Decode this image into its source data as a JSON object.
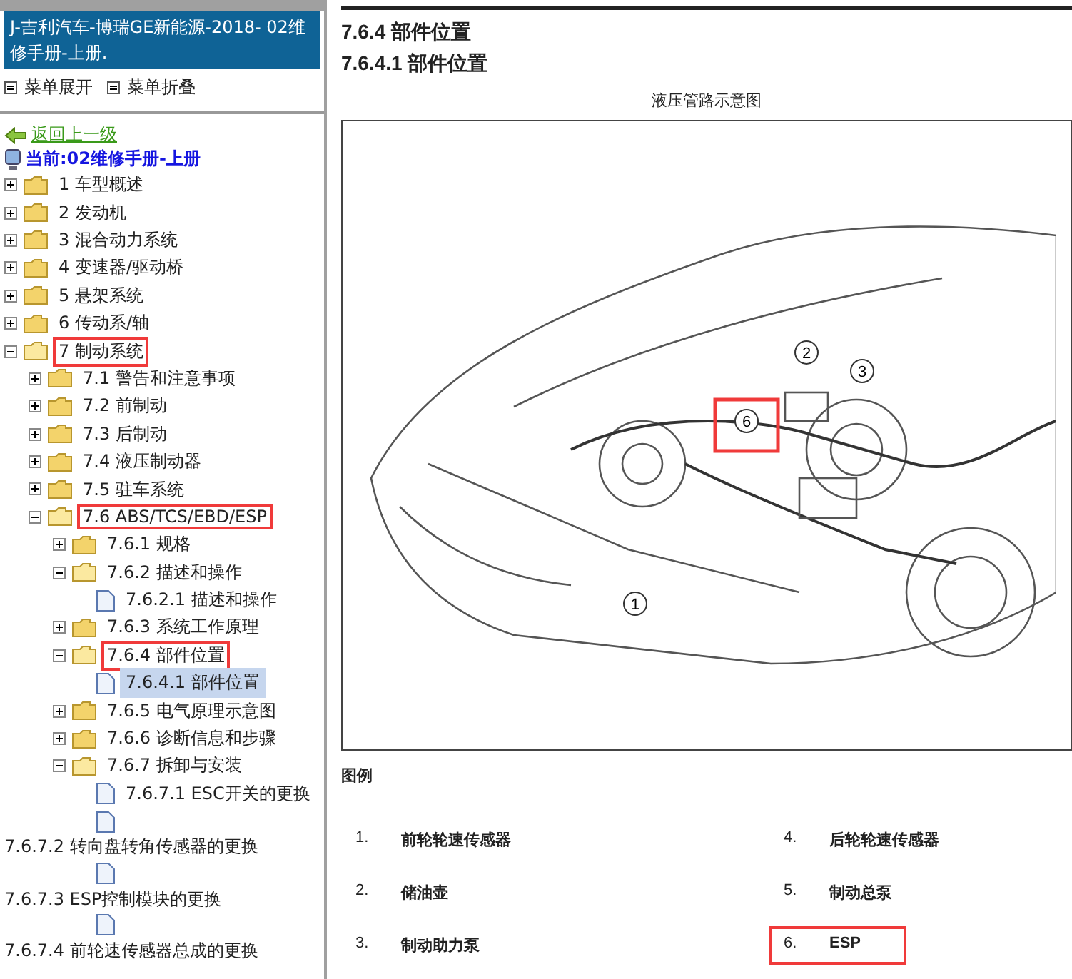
{
  "sidebar": {
    "title": "J-吉利汽车-博瑞GE新能源-2018- 02维修手册-上册.",
    "menu_actions": [
      "菜单展开",
      "菜单折叠"
    ],
    "back_link": "返回上一级",
    "current": "当前:02维修手册-上册",
    "tree": [
      {
        "label": "1 车型概述",
        "kind": "folder",
        "expanded": false,
        "highlighted": false,
        "selected": false
      },
      {
        "label": "2 发动机",
        "kind": "folder",
        "expanded": false,
        "highlighted": false,
        "selected": false
      },
      {
        "label": "3 混合动力系统",
        "kind": "folder",
        "expanded": false,
        "highlighted": false,
        "selected": false
      },
      {
        "label": "4 变速器/驱动桥",
        "kind": "folder",
        "expanded": false,
        "highlighted": false,
        "selected": false
      },
      {
        "label": "5 悬架系统",
        "kind": "folder",
        "expanded": false,
        "highlighted": false,
        "selected": false
      },
      {
        "label": "6 传动系/轴",
        "kind": "folder",
        "expanded": false,
        "highlighted": false,
        "selected": false
      },
      {
        "label": "7 制动系统",
        "kind": "folder",
        "expanded": true,
        "highlighted": true,
        "selected": false,
        "children": [
          {
            "label": "7.1 警告和注意事项",
            "kind": "folder",
            "expanded": false,
            "highlighted": false,
            "selected": false
          },
          {
            "label": "7.2 前制动",
            "kind": "folder",
            "expanded": false,
            "highlighted": false,
            "selected": false
          },
          {
            "label": "7.3 后制动",
            "kind": "folder",
            "expanded": false,
            "highlighted": false,
            "selected": false
          },
          {
            "label": "7.4 液压制动器",
            "kind": "folder",
            "expanded": false,
            "highlighted": false,
            "selected": false
          },
          {
            "label": "7.5 驻车系统",
            "kind": "folder",
            "expanded": false,
            "highlighted": false,
            "selected": false
          },
          {
            "label": "7.6 ABS/TCS/EBD/ESP",
            "kind": "folder",
            "expanded": true,
            "highlighted": true,
            "selected": false,
            "children": [
              {
                "label": "7.6.1 规格",
                "kind": "folder",
                "expanded": false,
                "highlighted": false,
                "selected": false
              },
              {
                "label": "7.6.2 描述和操作",
                "kind": "folder",
                "expanded": true,
                "highlighted": false,
                "selected": false,
                "children": [
                  {
                    "label": "7.6.2.1 描述和操作",
                    "kind": "doc",
                    "highlighted": false,
                    "selected": false
                  }
                ]
              },
              {
                "label": "7.6.3 系统工作原理",
                "kind": "folder",
                "expanded": false,
                "highlighted": false,
                "selected": false
              },
              {
                "label": "7.6.4 部件位置",
                "kind": "folder",
                "expanded": true,
                "highlighted": true,
                "selected": false,
                "children": [
                  {
                    "label": "7.6.4.1 部件位置",
                    "kind": "doc",
                    "highlighted": false,
                    "selected": true
                  }
                ]
              },
              {
                "label": "7.6.5 电气原理示意图",
                "kind": "folder",
                "expanded": false,
                "highlighted": false,
                "selected": false
              },
              {
                "label": "7.6.6 诊断信息和步骤",
                "kind": "folder",
                "expanded": false,
                "highlighted": false,
                "selected": false
              },
              {
                "label": "7.6.7 拆卸与安装",
                "kind": "folder",
                "expanded": true,
                "highlighted": false,
                "selected": false,
                "children": [
                  {
                    "label": "7.6.7.1 ESC开关的更换",
                    "kind": "doc",
                    "highlighted": false,
                    "selected": false
                  },
                  {
                    "label": "7.6.7.2 转向盘转角传感器的更换",
                    "kind": "wrapped",
                    "highlighted": false,
                    "selected": false
                  },
                  {
                    "label": "7.6.7.3 ESP控制模块的更换",
                    "kind": "wrapped",
                    "highlighted": false,
                    "selected": false
                  },
                  {
                    "label": "7.6.7.4 前轮速传感器总成的更换",
                    "kind": "wrapped",
                    "highlighted": false,
                    "selected": false
                  }
                ]
              }
            ]
          }
        ]
      }
    ]
  },
  "document": {
    "heading": "7.6.4 部件位置",
    "subheading": "7.6.4.1 部件位置",
    "figure_caption": "液压管路示意图",
    "callouts": [
      {
        "label": "1",
        "highlighted": false
      },
      {
        "label": "2",
        "highlighted": false
      },
      {
        "label": "3",
        "highlighted": false
      },
      {
        "label": "6",
        "highlighted": true
      }
    ],
    "legend_title": "图例",
    "legend": [
      {
        "number": "1.",
        "name": "前轮轮速传感器",
        "highlighted": false
      },
      {
        "number": "4.",
        "name": "后轮轮速传感器",
        "highlighted": false
      },
      {
        "number": "2.",
        "name": "储油壶",
        "highlighted": false
      },
      {
        "number": "5.",
        "name": "制动总泵",
        "highlighted": false
      },
      {
        "number": "3.",
        "name": "制动助力泵",
        "highlighted": false
      },
      {
        "number": "6.",
        "name": "ESP",
        "highlighted": true
      }
    ]
  }
}
